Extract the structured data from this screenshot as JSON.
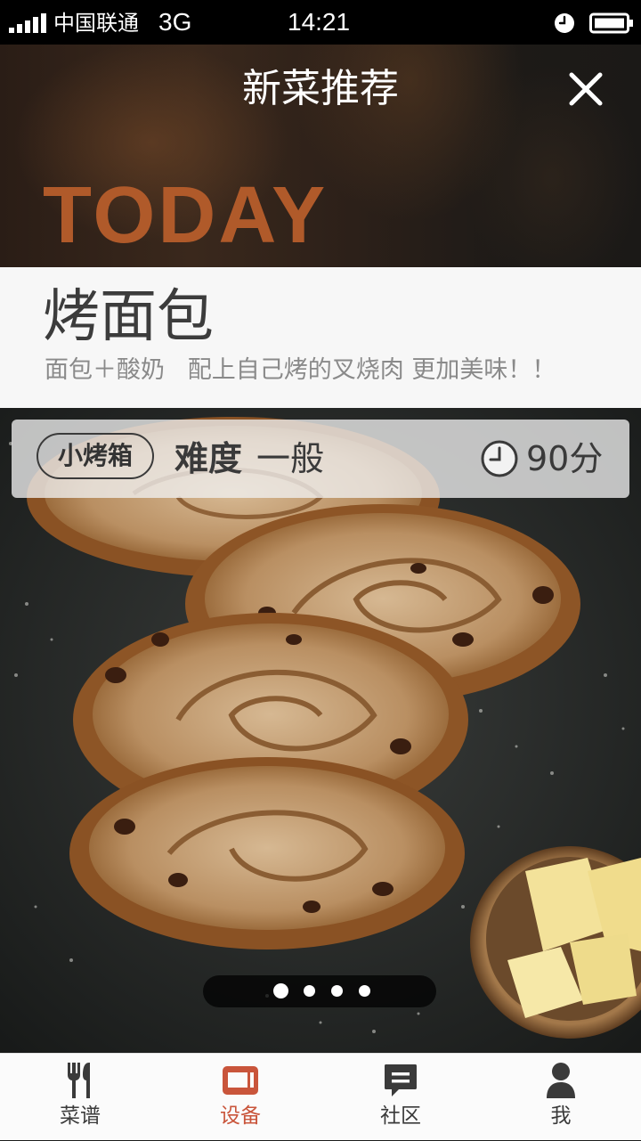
{
  "status_bar": {
    "carrier": "中国联通",
    "network": "3G",
    "time": "14:21"
  },
  "header": {
    "title": "新菜推荐",
    "banner": "TODAY",
    "close_icon": "close-icon"
  },
  "recipe": {
    "name": "烤面包",
    "description": "面包＋酸奶   配上自己烤的叉烧肉 更加美味！！",
    "device": "小烤箱",
    "difficulty_label": "难度",
    "difficulty_value": "一般",
    "time": "90分"
  },
  "pager": {
    "total": 4,
    "current": 1
  },
  "tabs": [
    {
      "label": "菜谱",
      "icon": "fork-spoon-icon",
      "active": false
    },
    {
      "label": "设备",
      "icon": "device-icon",
      "active": true
    },
    {
      "label": "社区",
      "icon": "chat-bubble-icon",
      "active": false
    },
    {
      "label": "我",
      "icon": "person-icon",
      "active": false
    }
  ],
  "colors": {
    "accent": "#c9553b",
    "banner": "#b05a2a",
    "tab_text": "#3a3a3a"
  }
}
